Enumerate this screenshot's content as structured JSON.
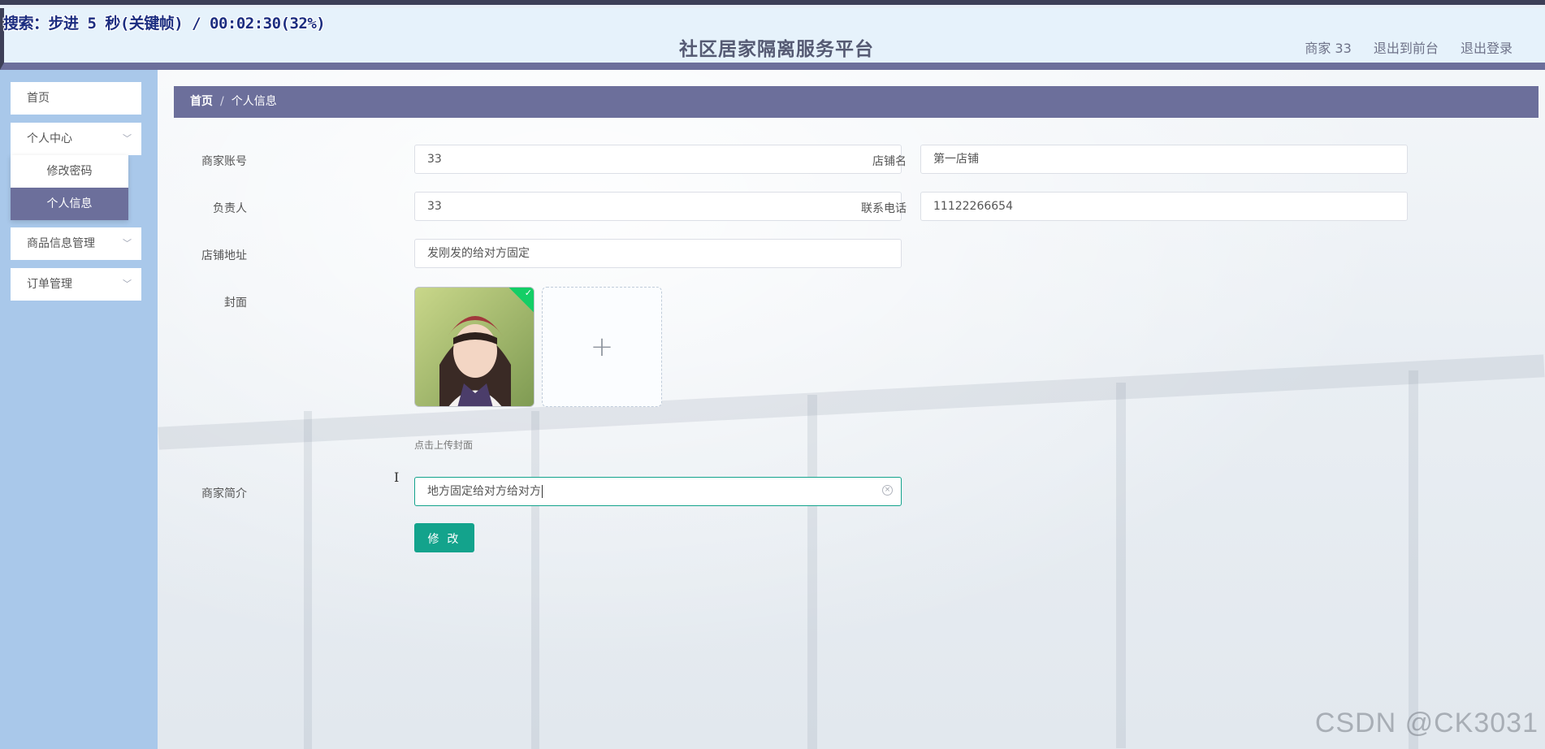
{
  "overlay": {
    "text": "搜索：步进 5 秒(关键帧) / 00:02:30(32%)"
  },
  "header": {
    "title": "社区居家隔离服务平台",
    "user": "商家 33",
    "to_front": "退出到前台",
    "logout": "退出登录"
  },
  "sidebar": {
    "home": "首页",
    "personal_center": "个人中心",
    "submenu": {
      "change_password": "修改密码",
      "personal_info": "个人信息"
    },
    "goods": "商品信息管理",
    "orders": "订单管理"
  },
  "breadcrumb": {
    "home": "首页",
    "separator": "/",
    "current": "个人信息"
  },
  "form": {
    "account_label": "商家账号",
    "account_value": "33",
    "shop_label": "店铺名",
    "shop_value": "第一店铺",
    "manager_label": "负责人",
    "manager_value": "33",
    "phone_label": "联系电话",
    "phone_value": "11122266654",
    "address_label": "店铺地址",
    "address_value": "发刚发的给对方固定",
    "cover_label": "封面",
    "upload_hint": "点击上传封面",
    "intro_label": "商家简介",
    "intro_value": "地方固定给对方给对方",
    "submit_label": "修 改"
  },
  "watermark": "CSDN @CK3031",
  "colors": {
    "accent": "#13a38c",
    "nav": "#6c6f9b",
    "sidebar": "#a9c8ea"
  }
}
